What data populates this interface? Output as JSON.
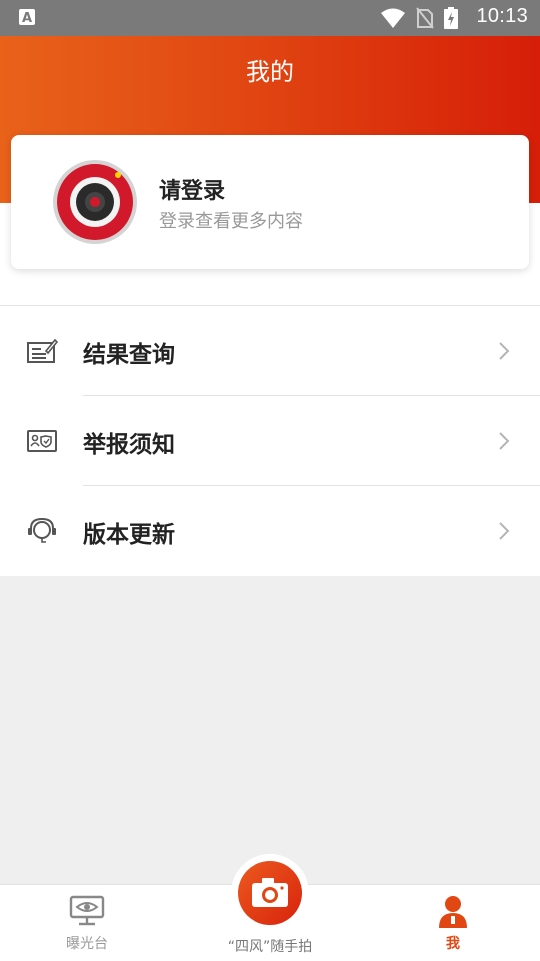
{
  "status_bar": {
    "time": "10:13"
  },
  "header": {
    "title": "我的"
  },
  "login_card": {
    "title": "请登录",
    "subtitle": "登录查看更多内容"
  },
  "menu": [
    {
      "label": "结果查询",
      "icon": "edit-document-icon"
    },
    {
      "label": "举报须知",
      "icon": "id-card-icon"
    },
    {
      "label": "版本更新",
      "icon": "headset-icon"
    }
  ],
  "tabbar": {
    "tab_left": "曝光台",
    "tab_center": "“四风”随手拍",
    "tab_right": "我"
  },
  "colors": {
    "accent": "#e14712",
    "header_start": "#e8621a",
    "header_end": "#d61e08"
  }
}
